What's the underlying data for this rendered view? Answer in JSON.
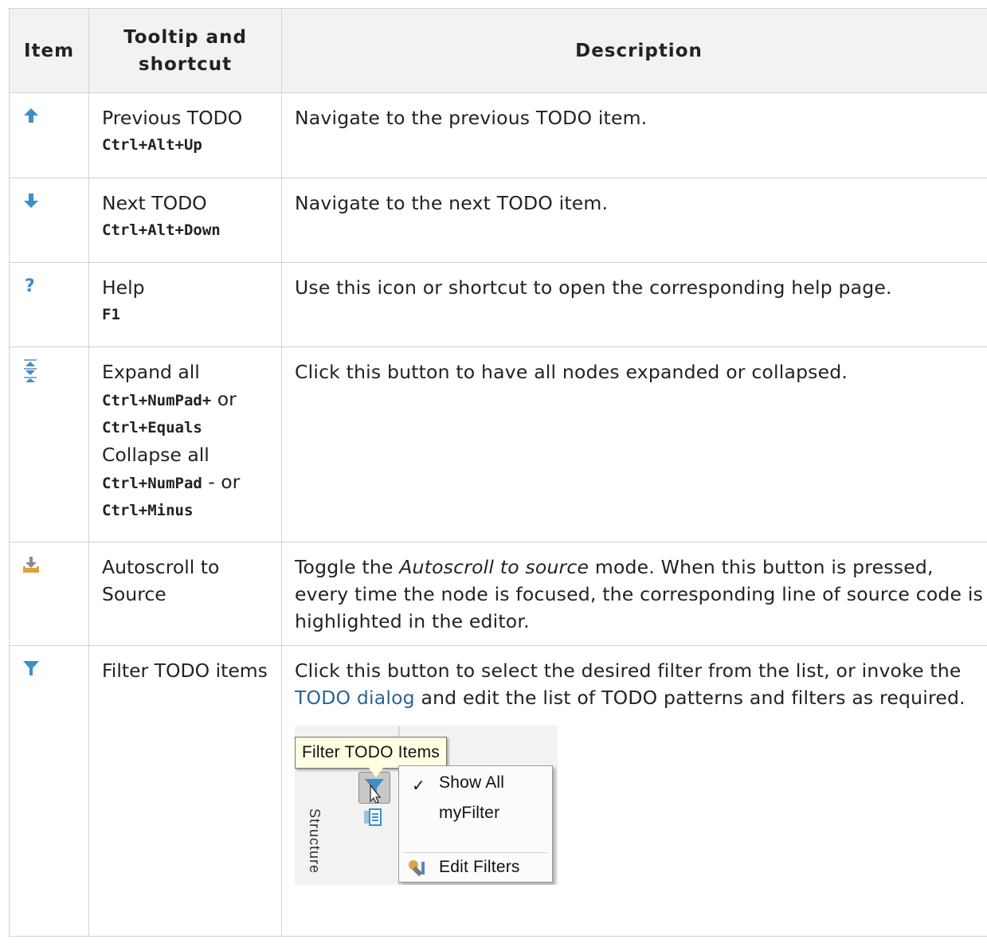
{
  "headers": {
    "item": "Item",
    "tooltip_line1": "Tooltip and",
    "tooltip_line2": "shortcut",
    "description": "Description"
  },
  "rows": [
    {
      "icon": "arrow-up-icon",
      "tooltip": "Previous TODO",
      "shortcut": "Ctrl+Alt+Up",
      "description": "Navigate to the previous TODO item."
    },
    {
      "icon": "arrow-down-icon",
      "tooltip": "Next TODO",
      "shortcut": "Ctrl+Alt+Down",
      "description": "Navigate to the next TODO item."
    },
    {
      "icon": "help-icon",
      "tooltip": "Help",
      "shortcut": "F1",
      "description": "Use this icon or shortcut to open the corresponding help page."
    },
    {
      "icon": "expand-collapse-icon",
      "tooltip": "Expand all",
      "shortcut_a": "Ctrl+NumPad+",
      "or_1": "or",
      "shortcut_b": "Ctrl+Equals",
      "tooltip2": "Collapse all",
      "shortcut_c": "Ctrl+NumPad",
      "or_2": "- or",
      "shortcut_d": "Ctrl+Minus",
      "description": "Click this button to have all nodes expanded or collapsed."
    },
    {
      "icon": "autoscroll-icon",
      "tooltip": "Autoscroll to Source",
      "desc_pre": "Toggle the ",
      "desc_em": "Autoscroll to source",
      "desc_post": " mode. When this button is pressed, every time the node is focused, the corresponding line of source code is highlighted in the editor."
    },
    {
      "icon": "filter-icon",
      "tooltip": "Filter TODO items",
      "desc_pre": "Click this button to select the desired filter from the list, or invoke the ",
      "desc_link": "TODO dialog",
      "desc_post": " and edit the list of TODO patterns and filters as required.",
      "screenshot": {
        "tooltip": "Filter TODO Items",
        "menu_items": [
          "Show All",
          "myFilter",
          "Edit Filters"
        ],
        "checkmark": "✓",
        "side_label": "Structure"
      }
    }
  ],
  "colors": {
    "icon_blue": "#3d8fc6",
    "link": "#2a6496",
    "header_bg": "#f2f2f2",
    "tooltip_bg": "#ffffe1"
  }
}
